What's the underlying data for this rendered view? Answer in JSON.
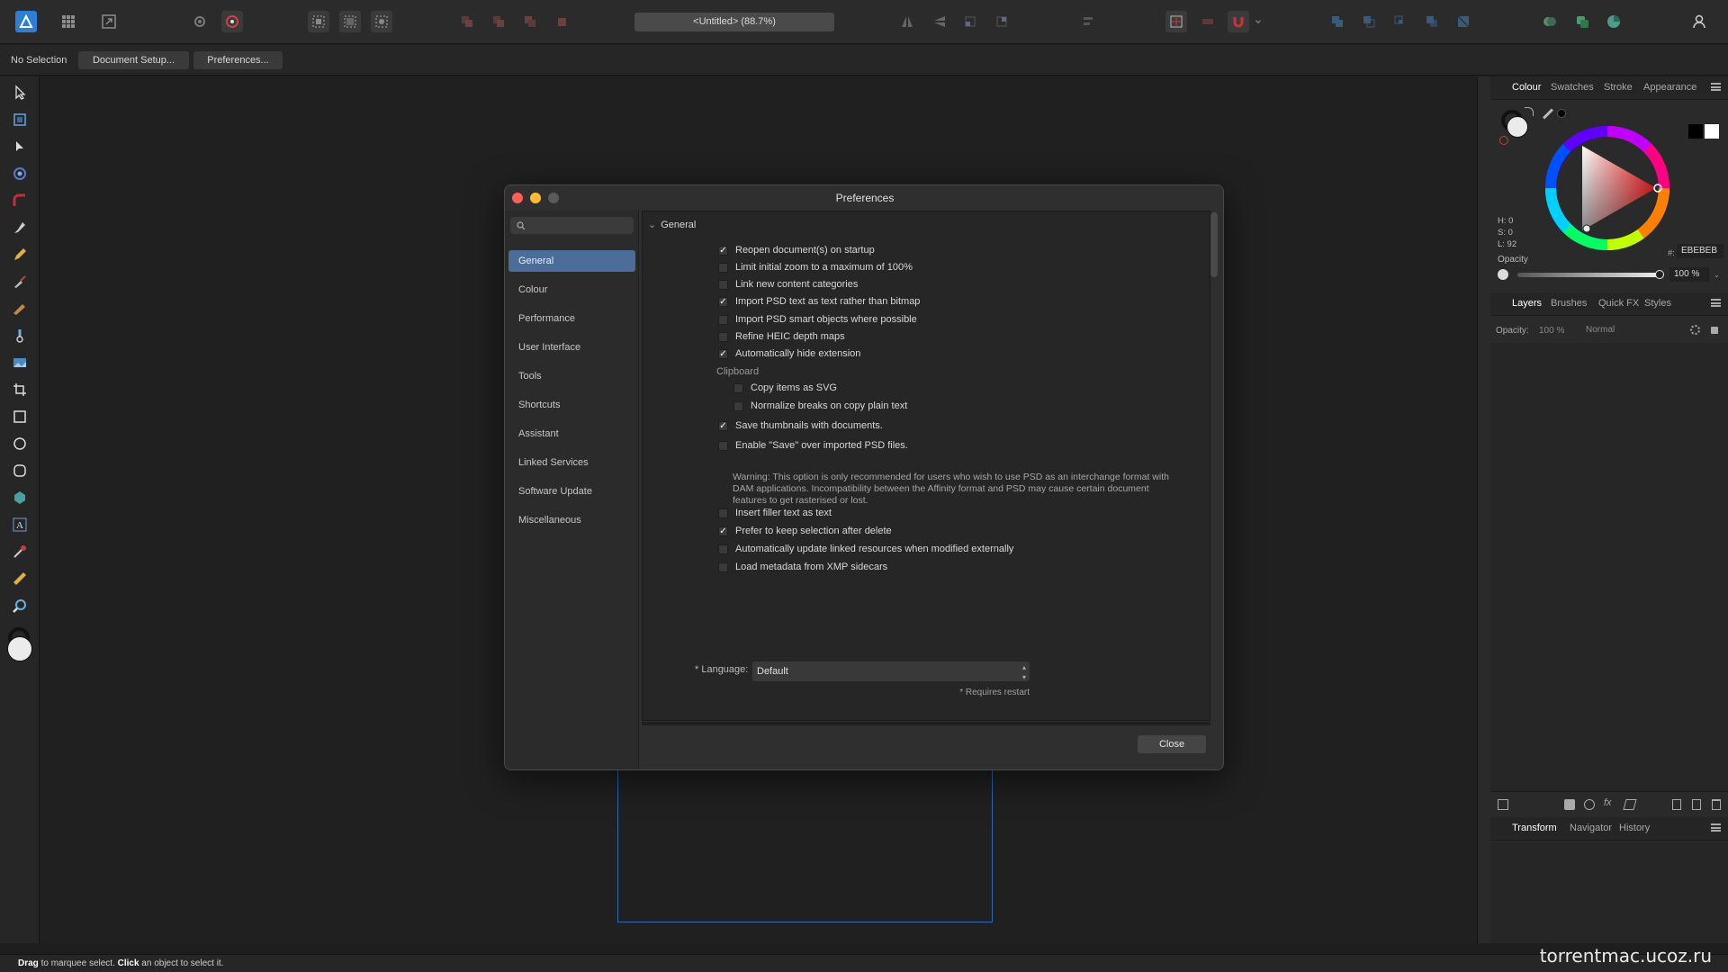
{
  "app": {
    "document_title": "<Untitled> (88.7%)"
  },
  "context_bar": {
    "selection_label": "No Selection",
    "document_setup_label": "Document Setup...",
    "preferences_label": "Preferences..."
  },
  "status_bar": {
    "drag": "Drag",
    "drag_rest": " to marquee select. ",
    "click": "Click",
    "click_rest": " an object to select it."
  },
  "watermark": "torrentmac.ucoz.ru",
  "colour_panel": {
    "tabs": [
      "Colour",
      "Swatches",
      "Stroke",
      "Appearance"
    ],
    "h_label": "H: 0",
    "s_label": "S: 0",
    "l_label": "L: 92",
    "opacity_label": "Opacity",
    "hex_prefix": "#:",
    "hex_value": "EBEBEB",
    "opacity_value": "100 %",
    "colors": {
      "ring_marker": "#ff2a2a",
      "triangle_tip": "#ff2020"
    }
  },
  "layers_panel": {
    "tabs": [
      "Layers",
      "Brushes",
      "Quick FX",
      "Styles"
    ],
    "opacity_label": "Opacity:",
    "opacity_value": "100 %",
    "blend_mode": "Normal"
  },
  "transform_panel": {
    "tabs": [
      "Transform",
      "Navigator",
      "History"
    ]
  },
  "preferences": {
    "title": "Preferences",
    "search_placeholder": "",
    "sidebar": [
      "General",
      "Colour",
      "Performance",
      "User Interface",
      "Tools",
      "Shortcuts",
      "Assistant",
      "Linked Services",
      "Software Update",
      "Miscellaneous"
    ],
    "selected_section": "General",
    "section_header": "General",
    "options": [
      {
        "label": "Reopen document(s) on startup",
        "checked": true
      },
      {
        "label": "Limit initial zoom to a maximum of 100%",
        "checked": false
      },
      {
        "label": "Link new content categories",
        "checked": false
      },
      {
        "label": "Import PSD text as text rather than bitmap",
        "checked": true
      },
      {
        "label": "Import PSD smart objects where possible",
        "checked": false
      },
      {
        "label": "Refine HEIC depth maps",
        "checked": false
      },
      {
        "label": "Automatically hide extension",
        "checked": true
      }
    ],
    "clipboard_label": "Clipboard",
    "clipboard_options": [
      {
        "label": "Copy items as SVG",
        "checked": false
      },
      {
        "label": "Normalize breaks on copy plain text",
        "checked": false
      }
    ],
    "options2": [
      {
        "label": "Save thumbnails with documents.",
        "checked": true
      },
      {
        "label": "Enable \"Save\" over imported PSD files.",
        "checked": false
      }
    ],
    "warning_text": "Warning: This option is only recommended for users who wish to use PSD as an interchange format with DAM applications. Incompatibility between the Affinity format and PSD may cause certain document features to get rasterised or lost.",
    "options3": [
      {
        "label": "Insert filler text as text",
        "checked": false
      },
      {
        "label": "Prefer to keep selection after delete",
        "checked": true
      },
      {
        "label": "Automatically update linked resources when modified externally",
        "checked": false
      },
      {
        "label": "Load metadata from XMP sidecars",
        "checked": false
      }
    ],
    "language_label": "* Language:",
    "language_value": "Default",
    "requires_restart": "* Requires restart",
    "close_label": "Close"
  }
}
